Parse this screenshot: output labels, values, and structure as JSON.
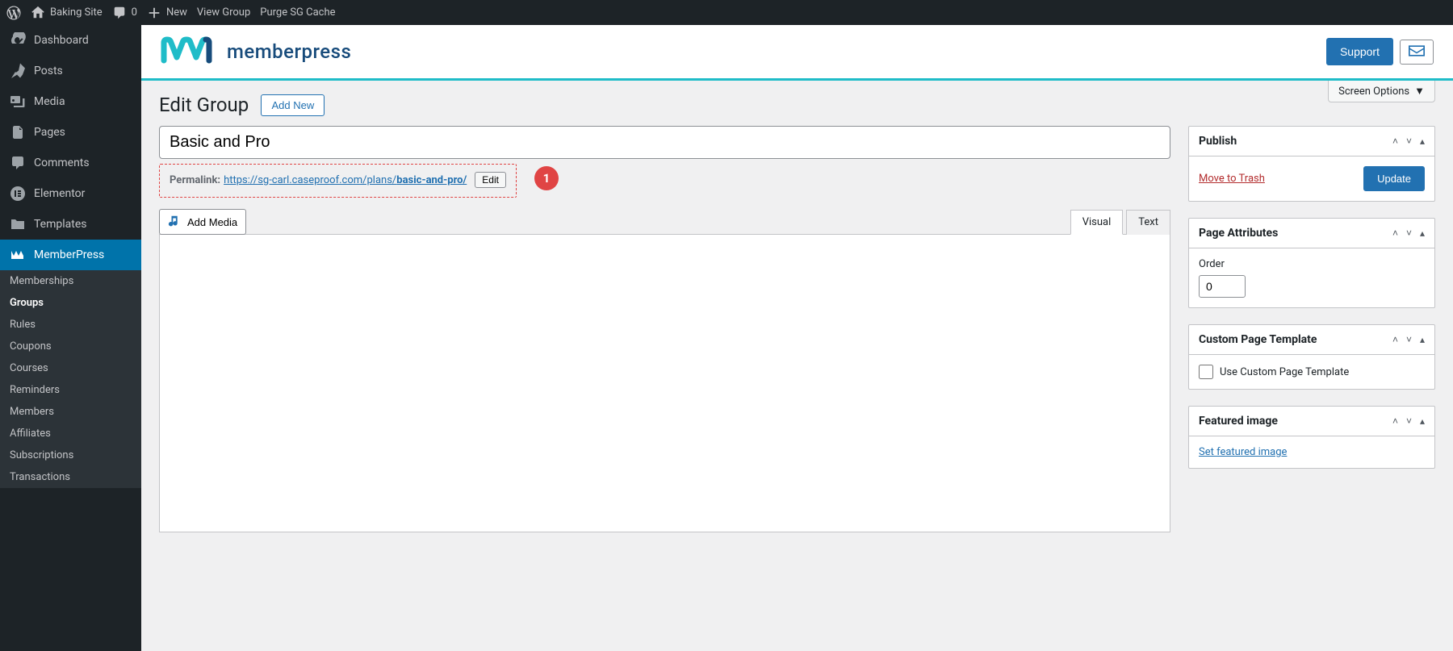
{
  "topbar": {
    "site_name": "Baking Site",
    "comment_count": "0",
    "new_label": "New",
    "view_group": "View Group",
    "purge_cache": "Purge SG Cache"
  },
  "sidebar": {
    "dashboard": "Dashboard",
    "posts": "Posts",
    "media": "Media",
    "pages": "Pages",
    "comments": "Comments",
    "elementor": "Elementor",
    "templates": "Templates",
    "memberpress": "MemberPress",
    "sub": {
      "memberships": "Memberships",
      "groups": "Groups",
      "rules": "Rules",
      "coupons": "Coupons",
      "courses": "Courses",
      "reminders": "Reminders",
      "members": "Members",
      "affiliates": "Affiliates",
      "subscriptions": "Subscriptions",
      "transactions": "Transactions"
    }
  },
  "brand": {
    "name": "memberpress",
    "support": "Support"
  },
  "page": {
    "screen_options": "Screen Options",
    "title": "Edit Group",
    "add_new": "Add New",
    "group_title_value": "Basic and Pro",
    "permalink_label": "Permalink:",
    "permalink_base": "https://sg-carl.caseproof.com/plans/",
    "permalink_slug": "basic-and-pro/",
    "edit": "Edit",
    "annotation": "1",
    "add_media": "Add Media",
    "tab_visual": "Visual",
    "tab_text": "Text"
  },
  "metaboxes": {
    "publish": {
      "title": "Publish",
      "trash": "Move to Trash",
      "update": "Update"
    },
    "page_attributes": {
      "title": "Page Attributes",
      "order_label": "Order",
      "order_value": "0"
    },
    "custom_template": {
      "title": "Custom Page Template",
      "checkbox_label": "Use Custom Page Template"
    },
    "featured_image": {
      "title": "Featured image",
      "link": "Set featured image"
    }
  }
}
